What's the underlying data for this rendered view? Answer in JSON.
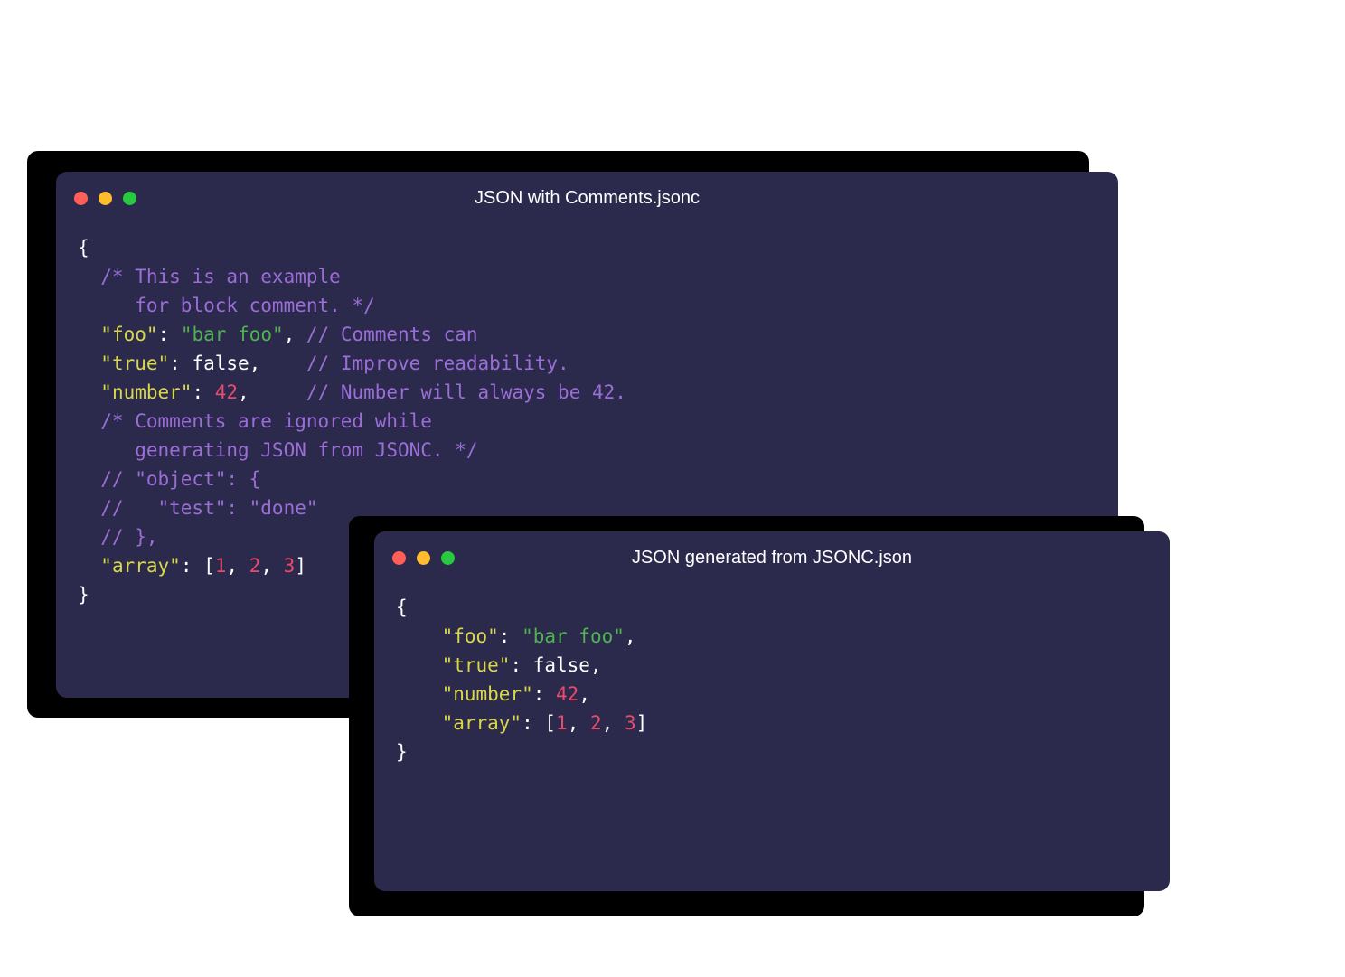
{
  "colors": {
    "window_bg": "#2b2a4c",
    "traffic_red": "#ff5f57",
    "traffic_yellow": "#febc2e",
    "traffic_green": "#28c840",
    "comment": "#9b6dd7",
    "key": "#d8d84a",
    "string": "#4fb34f",
    "number": "#e84a6b",
    "default": "#ffffff"
  },
  "window_a": {
    "title": "JSON with Comments.jsonc",
    "code_lines": [
      [
        {
          "cls": "c-brace",
          "t": "{"
        }
      ],
      [
        {
          "cls": "c-comment",
          "t": "  /* This is an example"
        }
      ],
      [
        {
          "cls": "c-comment",
          "t": "     for block comment. */"
        }
      ],
      [
        {
          "cls": "c-brace",
          "t": "  "
        },
        {
          "cls": "c-key",
          "t": "\"foo\""
        },
        {
          "cls": "c-colon",
          "t": ": "
        },
        {
          "cls": "c-string",
          "t": "\"bar foo\""
        },
        {
          "cls": "c-punct",
          "t": ", "
        },
        {
          "cls": "c-comment",
          "t": "// Comments can"
        }
      ],
      [
        {
          "cls": "c-brace",
          "t": "  "
        },
        {
          "cls": "c-key",
          "t": "\"true\""
        },
        {
          "cls": "c-colon",
          "t": ": "
        },
        {
          "cls": "c-bool",
          "t": "false"
        },
        {
          "cls": "c-punct",
          "t": ",    "
        },
        {
          "cls": "c-comment",
          "t": "// Improve readability."
        }
      ],
      [
        {
          "cls": "c-brace",
          "t": "  "
        },
        {
          "cls": "c-key",
          "t": "\"number\""
        },
        {
          "cls": "c-colon",
          "t": ": "
        },
        {
          "cls": "c-number",
          "t": "42"
        },
        {
          "cls": "c-punct",
          "t": ",     "
        },
        {
          "cls": "c-comment",
          "t": "// Number will always be 42."
        }
      ],
      [
        {
          "cls": "c-comment",
          "t": "  /* Comments are ignored while"
        }
      ],
      [
        {
          "cls": "c-comment",
          "t": "     generating JSON from JSONC. */"
        }
      ],
      [
        {
          "cls": "c-comment",
          "t": "  // \"object\": {"
        }
      ],
      [
        {
          "cls": "c-comment",
          "t": "  //   \"test\": \"done\""
        }
      ],
      [
        {
          "cls": "c-comment",
          "t": "  // },"
        }
      ],
      [
        {
          "cls": "c-brace",
          "t": "  "
        },
        {
          "cls": "c-key",
          "t": "\"array\""
        },
        {
          "cls": "c-colon",
          "t": ": "
        },
        {
          "cls": "c-bracket",
          "t": "["
        },
        {
          "cls": "c-number",
          "t": "1"
        },
        {
          "cls": "c-punct",
          "t": ", "
        },
        {
          "cls": "c-number",
          "t": "2"
        },
        {
          "cls": "c-punct",
          "t": ", "
        },
        {
          "cls": "c-number",
          "t": "3"
        },
        {
          "cls": "c-bracket",
          "t": "]"
        }
      ],
      [
        {
          "cls": "c-brace",
          "t": "}"
        }
      ]
    ]
  },
  "window_b": {
    "title": "JSON generated from JSONC.json",
    "code_lines": [
      [
        {
          "cls": "c-brace",
          "t": "{"
        }
      ],
      [
        {
          "cls": "c-brace",
          "t": "    "
        },
        {
          "cls": "c-key",
          "t": "\"foo\""
        },
        {
          "cls": "c-colon",
          "t": ": "
        },
        {
          "cls": "c-string",
          "t": "\"bar foo\""
        },
        {
          "cls": "c-punct",
          "t": ","
        }
      ],
      [
        {
          "cls": "c-brace",
          "t": "    "
        },
        {
          "cls": "c-key",
          "t": "\"true\""
        },
        {
          "cls": "c-colon",
          "t": ": "
        },
        {
          "cls": "c-bool",
          "t": "false"
        },
        {
          "cls": "c-punct",
          "t": ","
        }
      ],
      [
        {
          "cls": "c-brace",
          "t": "    "
        },
        {
          "cls": "c-key",
          "t": "\"number\""
        },
        {
          "cls": "c-colon",
          "t": ": "
        },
        {
          "cls": "c-number",
          "t": "42"
        },
        {
          "cls": "c-punct",
          "t": ","
        }
      ],
      [
        {
          "cls": "c-brace",
          "t": "    "
        },
        {
          "cls": "c-key",
          "t": "\"array\""
        },
        {
          "cls": "c-colon",
          "t": ": "
        },
        {
          "cls": "c-bracket",
          "t": "["
        },
        {
          "cls": "c-number",
          "t": "1"
        },
        {
          "cls": "c-punct",
          "t": ", "
        },
        {
          "cls": "c-number",
          "t": "2"
        },
        {
          "cls": "c-punct",
          "t": ", "
        },
        {
          "cls": "c-number",
          "t": "3"
        },
        {
          "cls": "c-bracket",
          "t": "]"
        }
      ],
      [
        {
          "cls": "c-brace",
          "t": "}"
        }
      ]
    ]
  }
}
